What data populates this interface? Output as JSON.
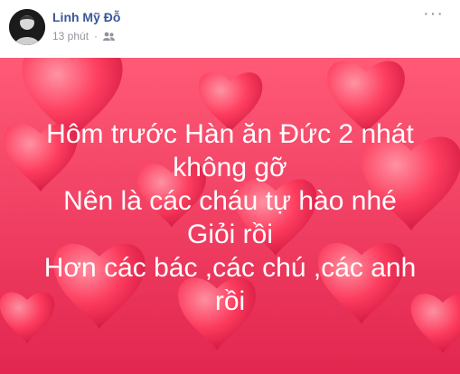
{
  "post": {
    "author": "Linh Mỹ Đỗ",
    "time": "13 phút",
    "audience_icon": "friends-icon",
    "more_icon": "more-options-icon",
    "colors": {
      "author": "#385898",
      "meta": "#90949c",
      "background_top": "#ff5a77",
      "background_bottom": "#e2264f",
      "text": "#ffffff"
    },
    "text_lines": [
      "Hôm trước Hàn ăn Đức 2 nhát",
      "không gỡ",
      "Nên là các cháu tự hào nhé",
      "Giỏi rồi",
      "Hơn các bác ,các chú ,các anh",
      "rồi"
    ]
  }
}
